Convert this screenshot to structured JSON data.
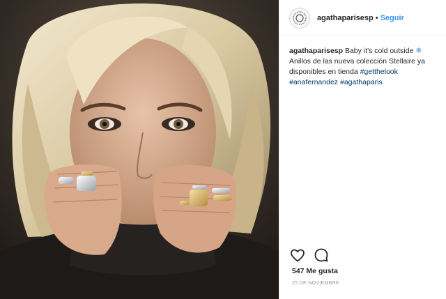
{
  "post": {
    "image_alt": "Woman with blonde hair covering her face with hands wearing rings",
    "colors": {
      "accent": "#3897f0",
      "hashtag": "#003569",
      "muted": "#999999"
    }
  },
  "header": {
    "username": "agathaparisesp",
    "separator": "•",
    "follow_label": "Seguir",
    "avatar_icon": "brand-logo-icon"
  },
  "caption": {
    "username": "agathaparisesp",
    "text_line1": "Baby it's cold outside",
    "emoji": "❄",
    "text_line2": "Anillos de las nueva colección Stellaire ya disponibles en tienda",
    "hashtags": [
      "#getthelook",
      "#anafernandez",
      "#agathaparis"
    ]
  },
  "actions": {
    "like_icon": "heart-icon",
    "comment_icon": "comment-icon"
  },
  "likes_text": "547 Me gusta",
  "date_text": "25 DE NOVIEMBRE"
}
